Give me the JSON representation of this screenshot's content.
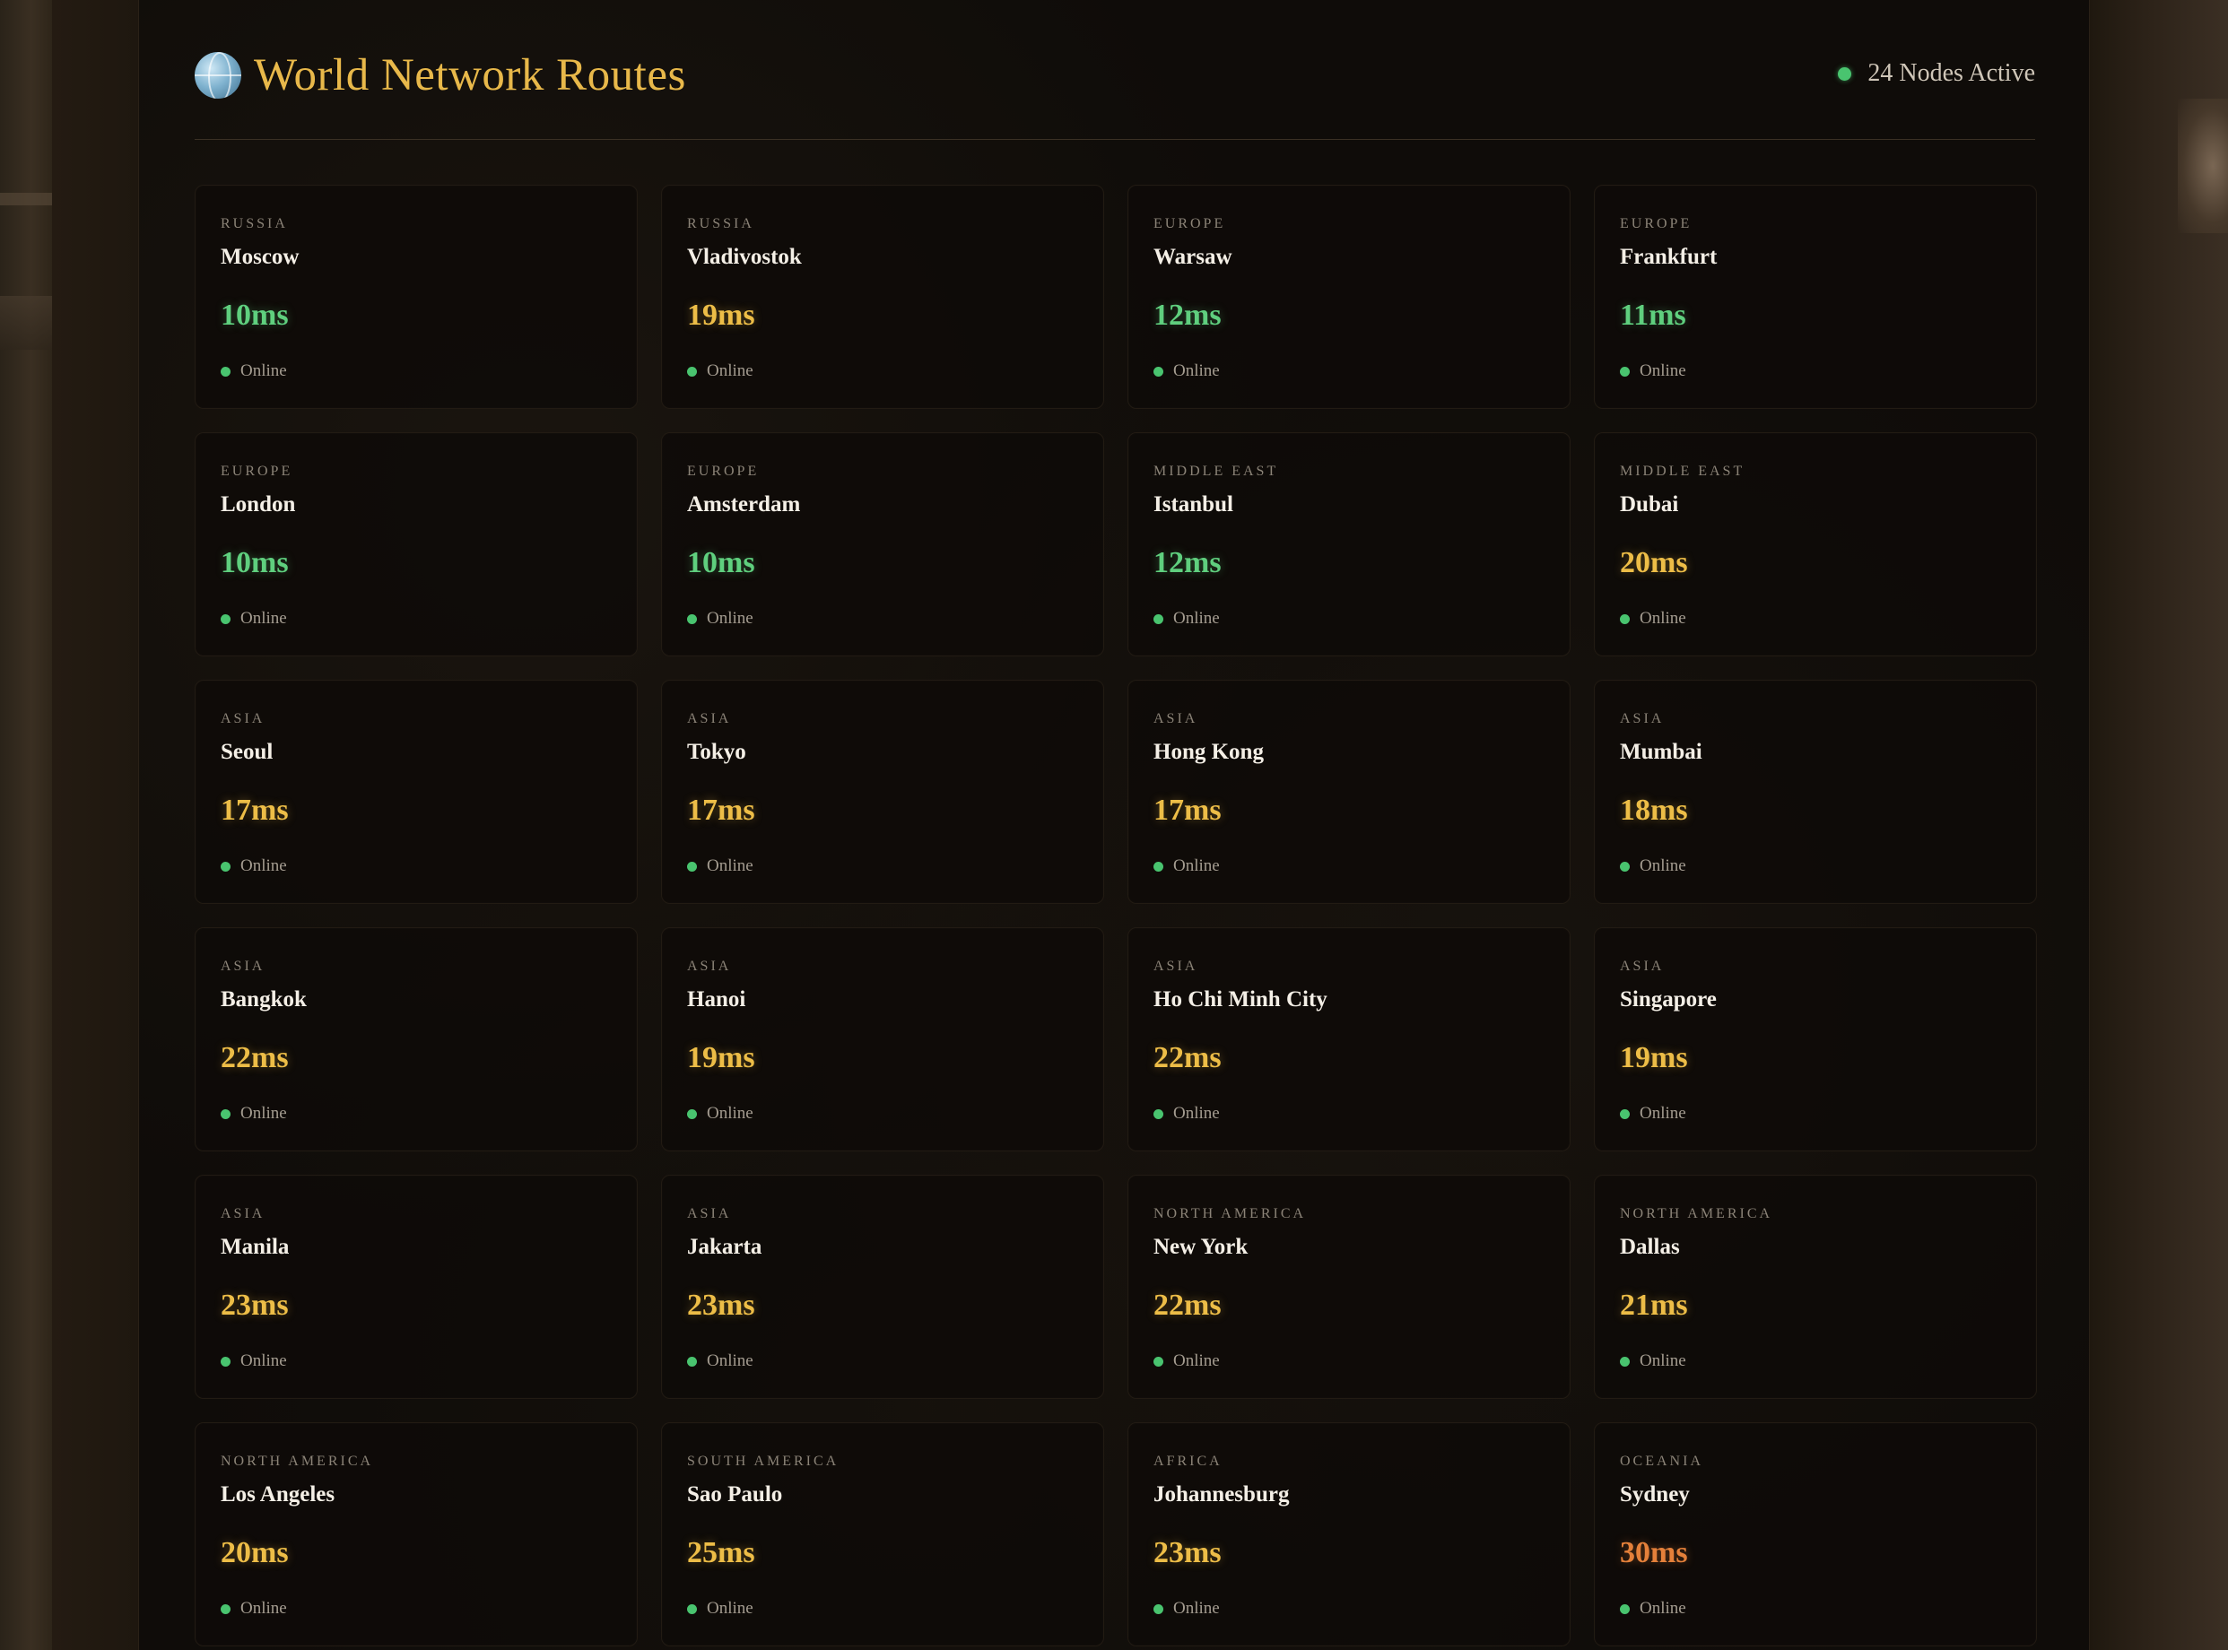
{
  "header": {
    "title": "World Network Routes",
    "nodes_active": "24 Nodes Active",
    "icon": "globe-icon"
  },
  "colors": {
    "accent": "#e8b84a",
    "online": "#49c46f",
    "latency_low": "#5fcf7e",
    "latency_mid": "#edbd47",
    "latency_high": "#e4803a"
  },
  "nodes": [
    {
      "region": "RUSSIA",
      "city": "Moscow",
      "latency": "10ms",
      "level": "green",
      "status": "Online"
    },
    {
      "region": "RUSSIA",
      "city": "Vladivostok",
      "latency": "19ms",
      "level": "yellow",
      "status": "Online"
    },
    {
      "region": "EUROPE",
      "city": "Warsaw",
      "latency": "12ms",
      "level": "green",
      "status": "Online"
    },
    {
      "region": "EUROPE",
      "city": "Frankfurt",
      "latency": "11ms",
      "level": "green",
      "status": "Online"
    },
    {
      "region": "EUROPE",
      "city": "London",
      "latency": "10ms",
      "level": "green",
      "status": "Online"
    },
    {
      "region": "EUROPE",
      "city": "Amsterdam",
      "latency": "10ms",
      "level": "green",
      "status": "Online"
    },
    {
      "region": "MIDDLE EAST",
      "city": "Istanbul",
      "latency": "12ms",
      "level": "green",
      "status": "Online"
    },
    {
      "region": "MIDDLE EAST",
      "city": "Dubai",
      "latency": "20ms",
      "level": "yellow",
      "status": "Online"
    },
    {
      "region": "ASIA",
      "city": "Seoul",
      "latency": "17ms",
      "level": "yellow",
      "status": "Online"
    },
    {
      "region": "ASIA",
      "city": "Tokyo",
      "latency": "17ms",
      "level": "yellow",
      "status": "Online"
    },
    {
      "region": "ASIA",
      "city": "Hong Kong",
      "latency": "17ms",
      "level": "yellow",
      "status": "Online"
    },
    {
      "region": "ASIA",
      "city": "Mumbai",
      "latency": "18ms",
      "level": "yellow",
      "status": "Online"
    },
    {
      "region": "ASIA",
      "city": "Bangkok",
      "latency": "22ms",
      "level": "yellow",
      "status": "Online"
    },
    {
      "region": "ASIA",
      "city": "Hanoi",
      "latency": "19ms",
      "level": "yellow",
      "status": "Online"
    },
    {
      "region": "ASIA",
      "city": "Ho Chi Minh City",
      "latency": "22ms",
      "level": "yellow",
      "status": "Online"
    },
    {
      "region": "ASIA",
      "city": "Singapore",
      "latency": "19ms",
      "level": "yellow",
      "status": "Online"
    },
    {
      "region": "ASIA",
      "city": "Manila",
      "latency": "23ms",
      "level": "yellow",
      "status": "Online"
    },
    {
      "region": "ASIA",
      "city": "Jakarta",
      "latency": "23ms",
      "level": "yellow",
      "status": "Online"
    },
    {
      "region": "NORTH AMERICA",
      "city": "New York",
      "latency": "22ms",
      "level": "yellow",
      "status": "Online"
    },
    {
      "region": "NORTH AMERICA",
      "city": "Dallas",
      "latency": "21ms",
      "level": "yellow",
      "status": "Online"
    },
    {
      "region": "NORTH AMERICA",
      "city": "Los Angeles",
      "latency": "20ms",
      "level": "yellow",
      "status": "Online"
    },
    {
      "region": "SOUTH AMERICA",
      "city": "Sao Paulo",
      "latency": "25ms",
      "level": "yellow",
      "status": "Online"
    },
    {
      "region": "AFRICA",
      "city": "Johannesburg",
      "latency": "23ms",
      "level": "yellow",
      "status": "Online"
    },
    {
      "region": "OCEANIA",
      "city": "Sydney",
      "latency": "30ms",
      "level": "orange",
      "status": "Online"
    }
  ]
}
